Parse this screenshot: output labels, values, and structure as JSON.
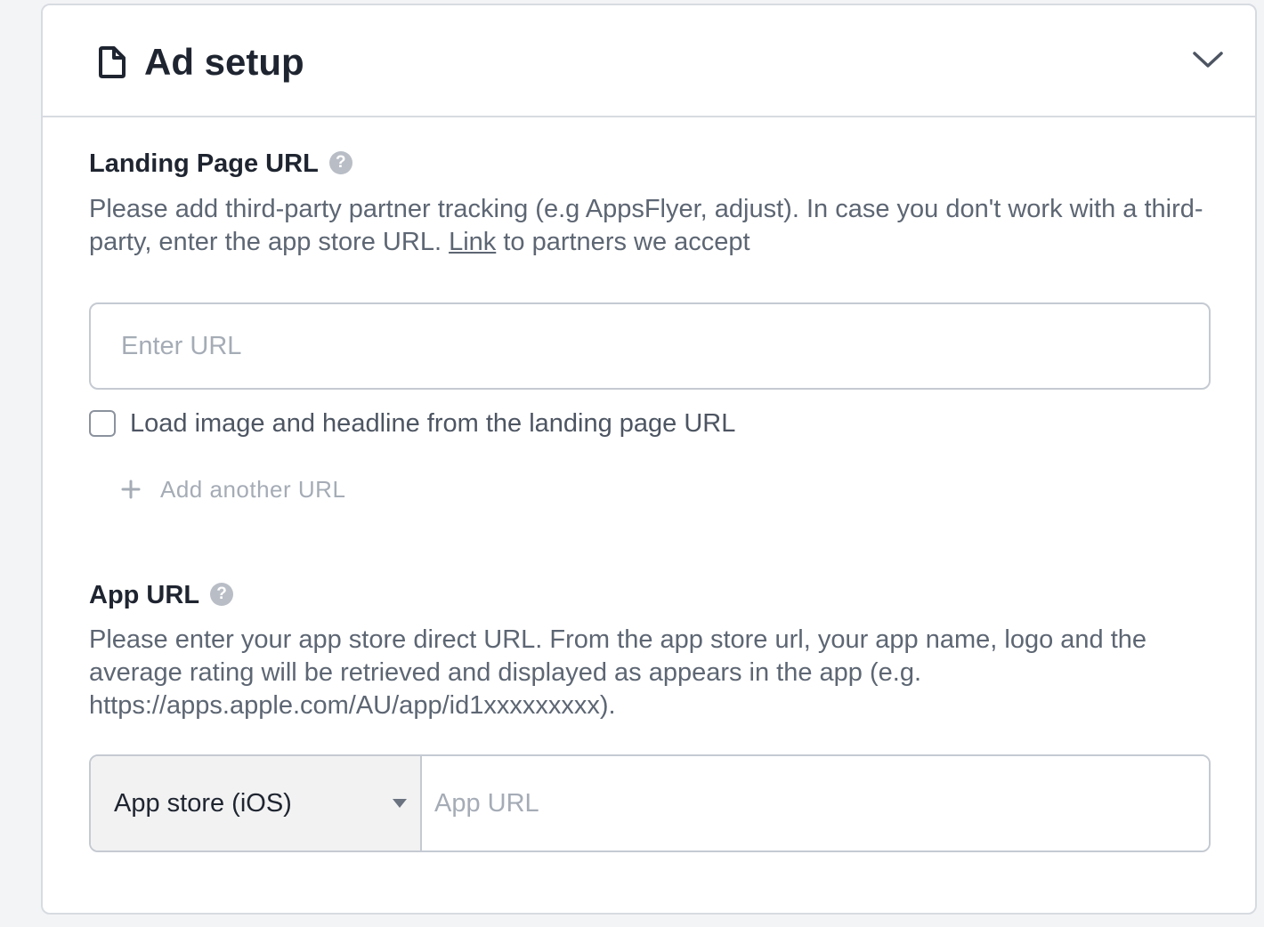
{
  "header": {
    "icon": "document-icon",
    "title": "Ad setup",
    "toggle_icon": "chevron-down-icon"
  },
  "landing_page": {
    "title": "Landing Page URL",
    "help_icon": "question-mark",
    "help_glyph": "?",
    "description_before_link": "Please add third-party partner tracking (e.g AppsFlyer, adjust). In case you don't work with a third-party, enter the app store URL.",
    "link_text": "Link",
    "description_after_link": "to partners we accept",
    "input_placeholder": "Enter URL",
    "input_value": "",
    "checkbox_label": "Load image and headline from the landing page URL",
    "checkbox_checked": false,
    "add_another_label": "Add another URL",
    "add_icon": "plus-icon"
  },
  "app_url": {
    "title": "App URL",
    "help_icon": "question-mark",
    "help_glyph": "?",
    "description": "Please enter your app store direct URL. From the app store url, your app name, logo and the average rating will be retrieved and displayed as appears in the app (e.g. https://apps.apple.com/AU/app/id1xxxxxxxxx).",
    "store_selected": "App store (iOS)",
    "store_dropdown_icon": "caret-down-icon",
    "input_placeholder": "App URL",
    "input_value": ""
  },
  "colors": {
    "border": "#d7dbe1",
    "text_primary": "#1f2530",
    "text_secondary": "#5d6673",
    "placeholder": "#a5acb6"
  }
}
